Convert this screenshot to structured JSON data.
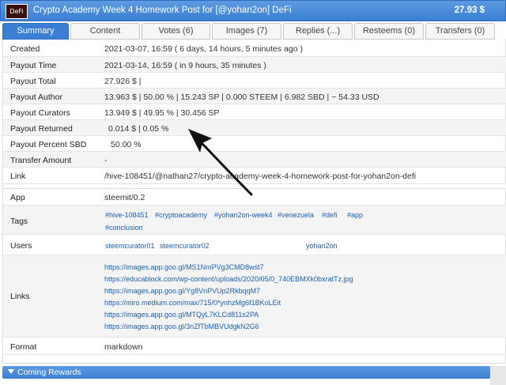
{
  "header": {
    "thumb_text": "DeFi",
    "title": "Crypto Academy Week 4 Homework Post for [@yohan2on] DeFi",
    "amount": "27.93 $"
  },
  "tabs": [
    "Summary",
    "Content",
    "Votes (6)",
    "Images (7)",
    "Replies (...)",
    "Resteems (0)",
    "Transfers (0)"
  ],
  "summary": {
    "created_label": "Created",
    "created_value": "2021-03-07, 16:59   ( 6 days, 14 hours, 5 minutes ago )",
    "payout_time_label": "Payout Time",
    "payout_time_value": "2021-03-14, 16:59   ( in 9 hours, 35 minutes )",
    "payout_total_label": "Payout Total",
    "payout_total_value": "27.926  $   |",
    "payout_author_label": "Payout Author",
    "payout_author_value": "13.963  $   |   50.00  %   |   15.243  SP   |   0.000  STEEM   |   6.982  SBD   |   ~ 54.33  USD",
    "payout_curators_label": "Payout Curators",
    "payout_curators_value": "13.949  $   |   49.95  %   |   30.456  SP",
    "payout_returned_label": "Payout Returned",
    "payout_returned_value": "0.014  $   |     0.05  %",
    "payout_sbd_label": "Payout Percent SBD",
    "payout_sbd_value": "50.00  %",
    "transfer_label": "Transfer Amount",
    "transfer_value": "-",
    "link_label": "Link",
    "link_value": "/hive-108451/@nathan27/crypto-academy-week-4-homework-post-for-yohan2on-defi"
  },
  "meta": {
    "app_label": "App",
    "app_value": "steemit/0.2",
    "tags_label": "Tags",
    "tags": [
      "#hive-108451",
      "#cryptoacademy",
      "#yohan2on-week4",
      "#venezuela",
      "#defi",
      "#app",
      "#conclusion"
    ],
    "users_label": "Users",
    "users": [
      "steemcurator01",
      "steemcurator02",
      "yohan2on"
    ],
    "links_label": "Links",
    "links": [
      "https://images.app.goo.gl/MS1NmPVg3CMD8wst7",
      "https://educablock.com/wp-content/uploads/2020/05/0_740EBMXk0bxratTz.jpg",
      "https://images.app.goo.gl/Yg8VnPVUp2RkbqqM7",
      "https://miro.medium.com/max/715/0*ynhzMg6f1BKoLEit",
      "https://images.app.goo.gl/MTQyL7KLCd811s2PA",
      "https://images.app.goo.gl/3nZfTbMBVUdgkN2G6"
    ],
    "format_label": "Format",
    "format_value": "markdown"
  },
  "footer": {
    "coming_rewards": "Coming Rewards"
  }
}
